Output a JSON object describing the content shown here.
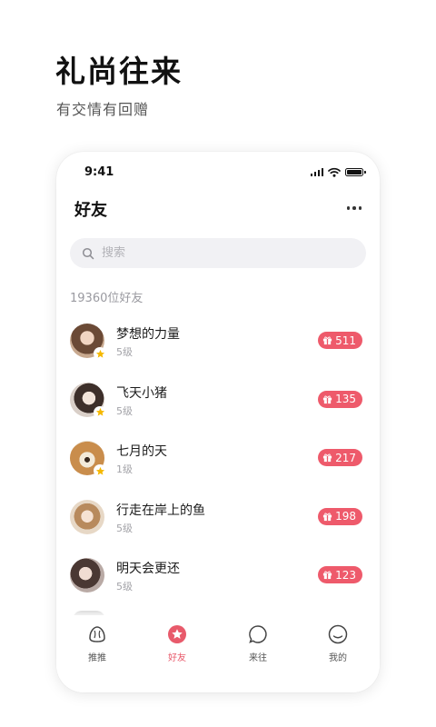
{
  "hero": {
    "title": "礼尚往来",
    "subtitle": "有交情有回赠"
  },
  "status_bar": {
    "time": "9:41"
  },
  "header": {
    "title": "好友",
    "more_icon": "more-dots-icon"
  },
  "search": {
    "placeholder": "搜索",
    "value": ""
  },
  "friend_count": "19360位好友",
  "friends": [
    {
      "name": "梦想的力量",
      "level": "5级",
      "gifts": "511",
      "avatar_color": "#a87a5c",
      "has_star": true
    },
    {
      "name": "飞天小猪",
      "level": "5级",
      "gifts": "135",
      "avatar_color": "#b9a292",
      "has_star": true
    },
    {
      "name": "七月的天",
      "level": "1级",
      "gifts": "217",
      "avatar_color": "#c79a5e",
      "has_star": true
    },
    {
      "name": "行走在岸上的鱼",
      "level": "5级",
      "gifts": "198",
      "avatar_color": "#d8bfa6",
      "has_star": false
    },
    {
      "name": "明天会更还",
      "level": "5级",
      "gifts": "123",
      "avatar_color": "#8f7d78",
      "has_star": false
    }
  ],
  "tabs": [
    {
      "label": "推推",
      "icon": "shell-icon",
      "active": false
    },
    {
      "label": "好友",
      "icon": "star-icon",
      "active": true
    },
    {
      "label": "来往",
      "icon": "chat-bubble-icon",
      "active": false
    },
    {
      "label": "我的",
      "icon": "profile-circle-icon",
      "active": false
    }
  ],
  "colors": {
    "accent": "#e85a6b",
    "badge": "#ee5a6b",
    "star": "#f5b800"
  }
}
